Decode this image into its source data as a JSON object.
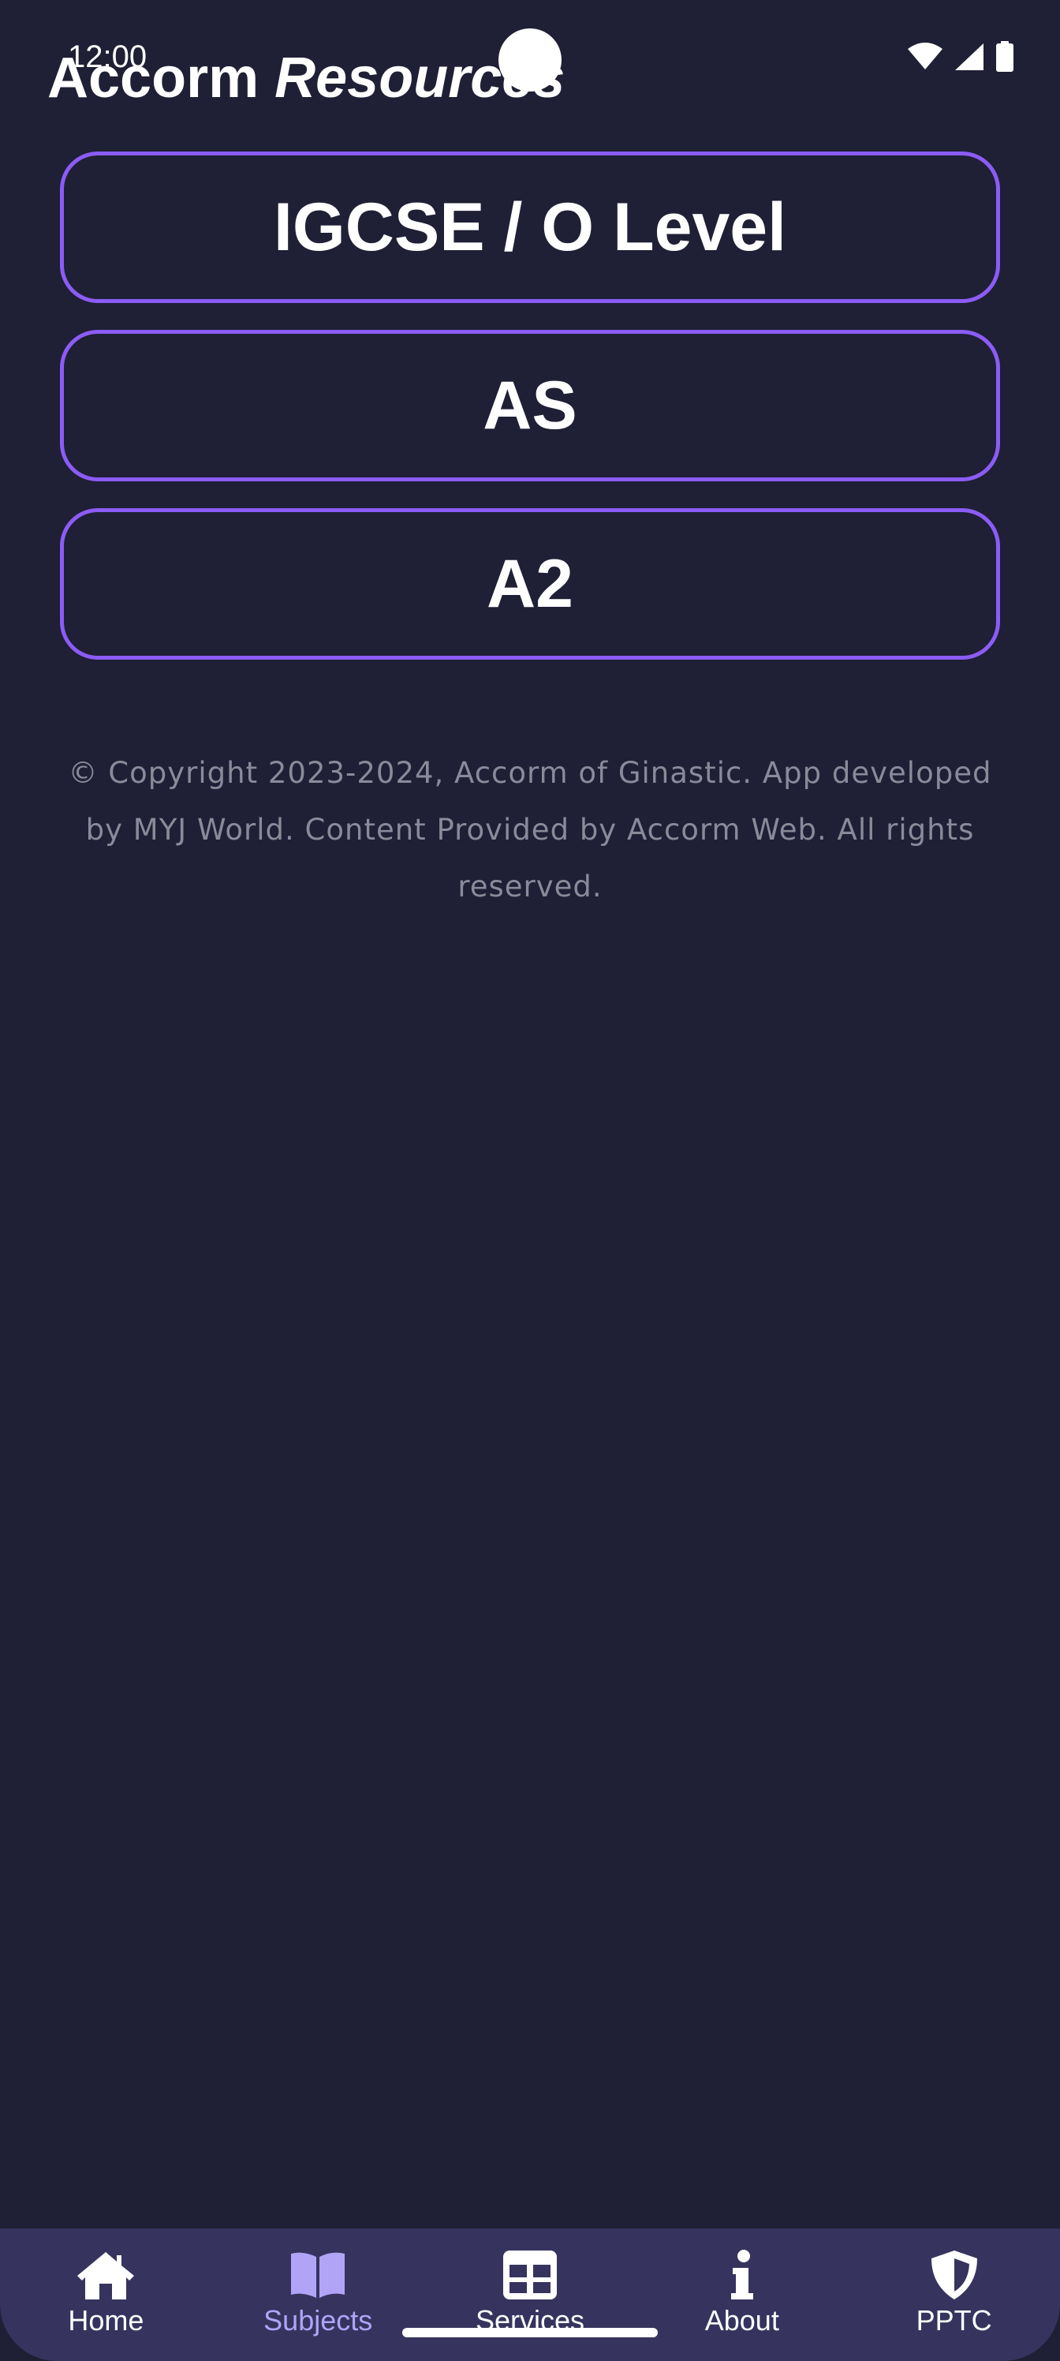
{
  "status_bar": {
    "time": "12:00"
  },
  "app": {
    "title_part1": "Accorm",
    "title_part2": "Resources"
  },
  "levels": [
    {
      "label": "IGCSE / O Level"
    },
    {
      "label": "AS"
    },
    {
      "label": "A2"
    }
  ],
  "footer": {
    "copyright": "© Copyright 2023-2024, Accorm of Ginastic. App developed by MYJ World. Content Provided by Accorm Web. All rights reserved."
  },
  "nav": {
    "active": "Subjects",
    "items": [
      {
        "label": "Home",
        "icon": "home-icon"
      },
      {
        "label": "Subjects",
        "icon": "book-icon"
      },
      {
        "label": "Services",
        "icon": "table-icon"
      },
      {
        "label": "About",
        "icon": "info-icon"
      },
      {
        "label": "PPTC",
        "icon": "shield-icon"
      }
    ]
  },
  "colors": {
    "background": "#1f1f35",
    "accent_border": "#8b5cf6",
    "nav_background": "#36345e",
    "nav_active": "#b1a4f7",
    "footer_text": "#8a8a99"
  }
}
